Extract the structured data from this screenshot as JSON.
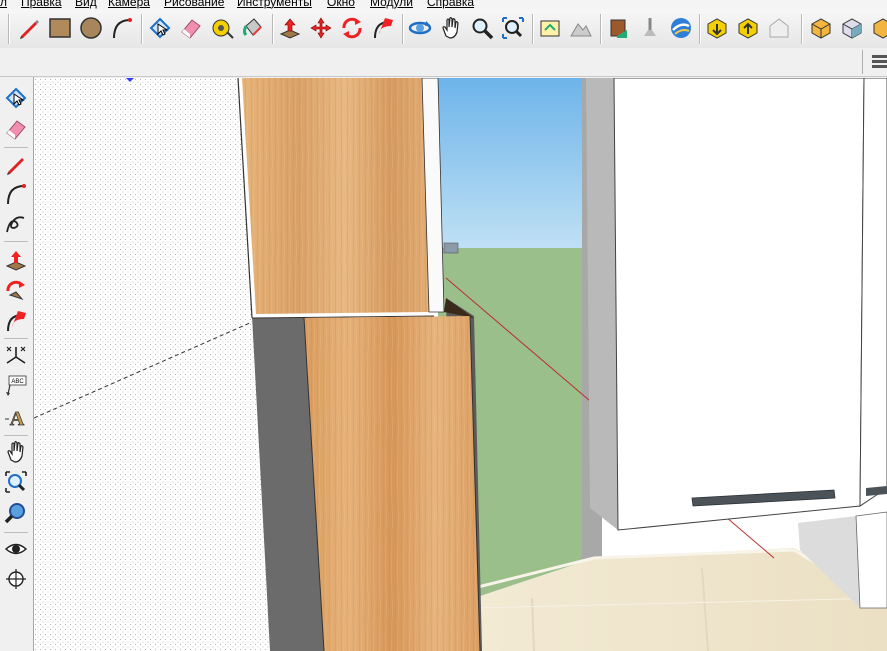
{
  "menu": {
    "items": [
      "л",
      "Правка",
      "Вид",
      "Камера",
      "Рисование",
      "Инструменты",
      "Окно",
      "Модули",
      "Справка"
    ]
  },
  "toolbar": {
    "tools": [
      {
        "name": "line-tool",
        "icon": "pencil-icon"
      },
      {
        "name": "rectangle-tool",
        "icon": "rectangle-icon"
      },
      {
        "name": "circle-tool",
        "icon": "circle-icon"
      },
      {
        "name": "arc-tool",
        "icon": "arc-icon"
      },
      {
        "name": "select-tool",
        "icon": "select-cursor-icon"
      },
      {
        "name": "eraser-tool",
        "icon": "eraser-icon"
      },
      {
        "name": "tape-measure-tool",
        "icon": "tape-measure-icon"
      },
      {
        "name": "paint-bucket-tool",
        "icon": "paint-bucket-icon"
      },
      {
        "name": "push-pull-tool",
        "icon": "push-pull-icon"
      },
      {
        "name": "move-tool",
        "icon": "move-icon"
      },
      {
        "name": "rotate-tool",
        "icon": "rotate-icon"
      },
      {
        "name": "follow-me-tool",
        "icon": "follow-me-icon"
      },
      {
        "name": "orbit-tool",
        "icon": "orbit-icon"
      },
      {
        "name": "pan-tool",
        "icon": "hand-icon"
      },
      {
        "name": "zoom-tool",
        "icon": "zoom-icon"
      },
      {
        "name": "zoom-extents-tool",
        "icon": "zoom-extents-icon"
      },
      {
        "name": "add-location-tool",
        "icon": "add-location-icon"
      },
      {
        "name": "toggle-terrain-tool",
        "icon": "terrain-icon"
      },
      {
        "name": "get-models-tool",
        "icon": "get-models-icon"
      },
      {
        "name": "share-model-tool",
        "icon": "share-model-icon"
      },
      {
        "name": "photo-textures-tool",
        "icon": "photo-textures-icon"
      },
      {
        "name": "google-earth-tool",
        "icon": "google-earth-icon"
      },
      {
        "name": "get-components-tool",
        "icon": "get-components-icon"
      },
      {
        "name": "share-component-tool",
        "icon": "share-component-icon"
      },
      {
        "name": "extension-warehouse-tool",
        "icon": "warehouse-icon"
      },
      {
        "name": "xray-style-tool",
        "icon": "xray-cube-icon"
      },
      {
        "name": "wireframe-style-tool",
        "icon": "wireframe-cube-icon"
      }
    ]
  },
  "left_toolbar": {
    "tools": [
      {
        "name": "select-tool",
        "icon": "select-cursor-icon"
      },
      {
        "name": "eraser-tool",
        "icon": "eraser-icon"
      },
      {
        "name": "line-tool",
        "icon": "pencil-icon"
      },
      {
        "name": "arc-tool",
        "icon": "arc-icon"
      },
      {
        "name": "freehand-tool",
        "icon": "freehand-icon"
      },
      {
        "name": "push-pull-tool",
        "icon": "push-pull-icon"
      },
      {
        "name": "rotate-tool",
        "icon": "rotate-icon"
      },
      {
        "name": "follow-me-tool",
        "icon": "follow-me-icon"
      },
      {
        "name": "axes-tool",
        "icon": "axes-icon"
      },
      {
        "name": "text-tool",
        "icon": "text-label-icon",
        "label": "ABC"
      },
      {
        "name": "3d-text-tool",
        "icon": "3d-text-icon",
        "label": "A"
      },
      {
        "name": "pan-tool",
        "icon": "hand-icon"
      },
      {
        "name": "zoom-window-tool",
        "icon": "zoom-window-icon"
      },
      {
        "name": "zoom-extents-tool",
        "icon": "zoom-extents-icon"
      },
      {
        "name": "look-around-tool",
        "icon": "eye-icon"
      },
      {
        "name": "position-camera-tool",
        "icon": "position-camera-icon"
      }
    ]
  },
  "colors": {
    "wood": "#dca062",
    "sky": "#8ec7ea",
    "ground": "#9bbf8b",
    "floor": "#eee4cc",
    "cabinet": "#ffffff",
    "shadow": "#666666"
  }
}
